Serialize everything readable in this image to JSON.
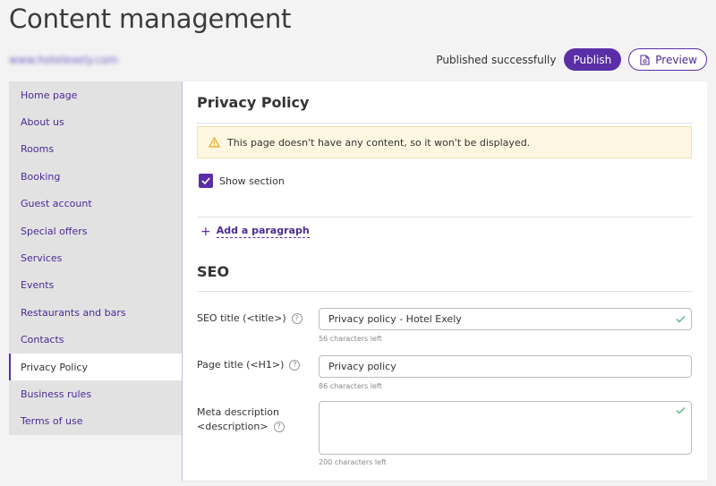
{
  "page": {
    "title": "Content management",
    "site_url": "www.hotelexely.com"
  },
  "topbar": {
    "status_text": "Published successfully",
    "publish_label": "Publish",
    "preview_label": "Preview"
  },
  "sidebar": {
    "items": [
      {
        "label": "Home page"
      },
      {
        "label": "About us"
      },
      {
        "label": "Rooms"
      },
      {
        "label": "Booking"
      },
      {
        "label": "Guest account"
      },
      {
        "label": "Special offers"
      },
      {
        "label": "Services"
      },
      {
        "label": "Events"
      },
      {
        "label": "Restaurants and bars"
      },
      {
        "label": "Contacts"
      },
      {
        "label": "Privacy Policy",
        "active": true
      },
      {
        "label": "Business rules"
      },
      {
        "label": "Terms of use"
      }
    ]
  },
  "main": {
    "section_title": "Privacy Policy",
    "warning_text": "This page doesn't have any content, so it won't be displayed.",
    "show_section_label": "Show section",
    "show_section_checked": true,
    "add_paragraph_label": "Add a paragraph",
    "seo": {
      "heading": "SEO",
      "seo_title_label": "SEO title (<title>)",
      "seo_title_value": "Privacy policy - Hotel Exely",
      "seo_title_hint": "56 characters left",
      "page_title_label": "Page title (<H1>)",
      "page_title_value": "Privacy policy",
      "page_title_hint": "86 characters left",
      "meta_label_line1": "Meta description",
      "meta_label_line2": "<description>",
      "meta_value": "",
      "meta_hint": "200 characters left"
    }
  },
  "colors": {
    "accent": "#5a2ea6",
    "link": "#4b2a94",
    "warning_bg": "#fdf6e0",
    "warning_icon": "#e6a817",
    "check_green": "#4caf7a"
  }
}
